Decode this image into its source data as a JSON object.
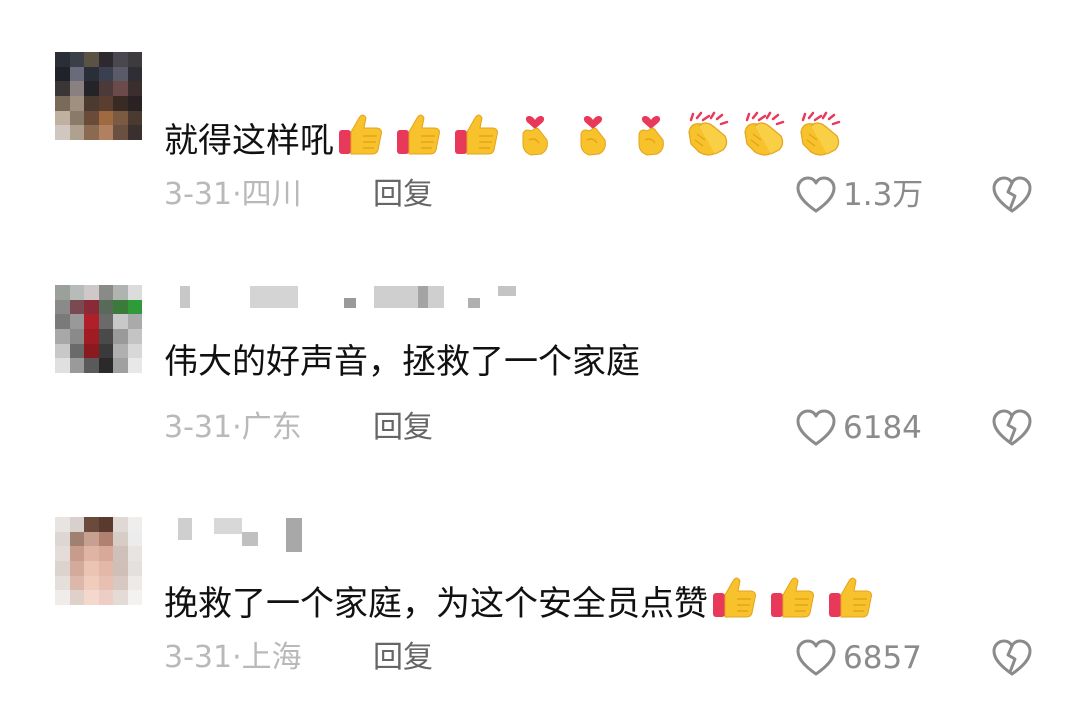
{
  "comments": [
    {
      "text": "就得这样吼",
      "emojis": [
        "thumbs-up-icon",
        "thumbs-up-icon",
        "thumbs-up-icon",
        "finger-heart-icon",
        "finger-heart-icon",
        "finger-heart-icon",
        "clapping-hands-icon",
        "clapping-hands-icon",
        "clapping-hands-icon"
      ],
      "date": "3-31",
      "location": "四川",
      "separator": "·",
      "reply_label": "回复",
      "likes": "1.3万"
    },
    {
      "text": "伟大的好声音，拯救了一个家庭",
      "emojis": [],
      "date": "3-31",
      "location": "广东",
      "separator": "·",
      "reply_label": "回复",
      "likes": "6184"
    },
    {
      "text": "挽救了一个家庭，为这个安全员点赞",
      "emojis": [
        "thumbs-up-icon",
        "thumbs-up-icon",
        "thumbs-up-icon"
      ],
      "date": "3-31",
      "location": "上海",
      "separator": "·",
      "reply_label": "回复",
      "likes": "6857"
    }
  ],
  "colors": {
    "like_outline": "#8b8b8b",
    "meta_text": "#b9b9b9",
    "reply_text": "#666666",
    "emoji_yellow": "#f7c22c",
    "emoji_heart": "#e8395a"
  }
}
